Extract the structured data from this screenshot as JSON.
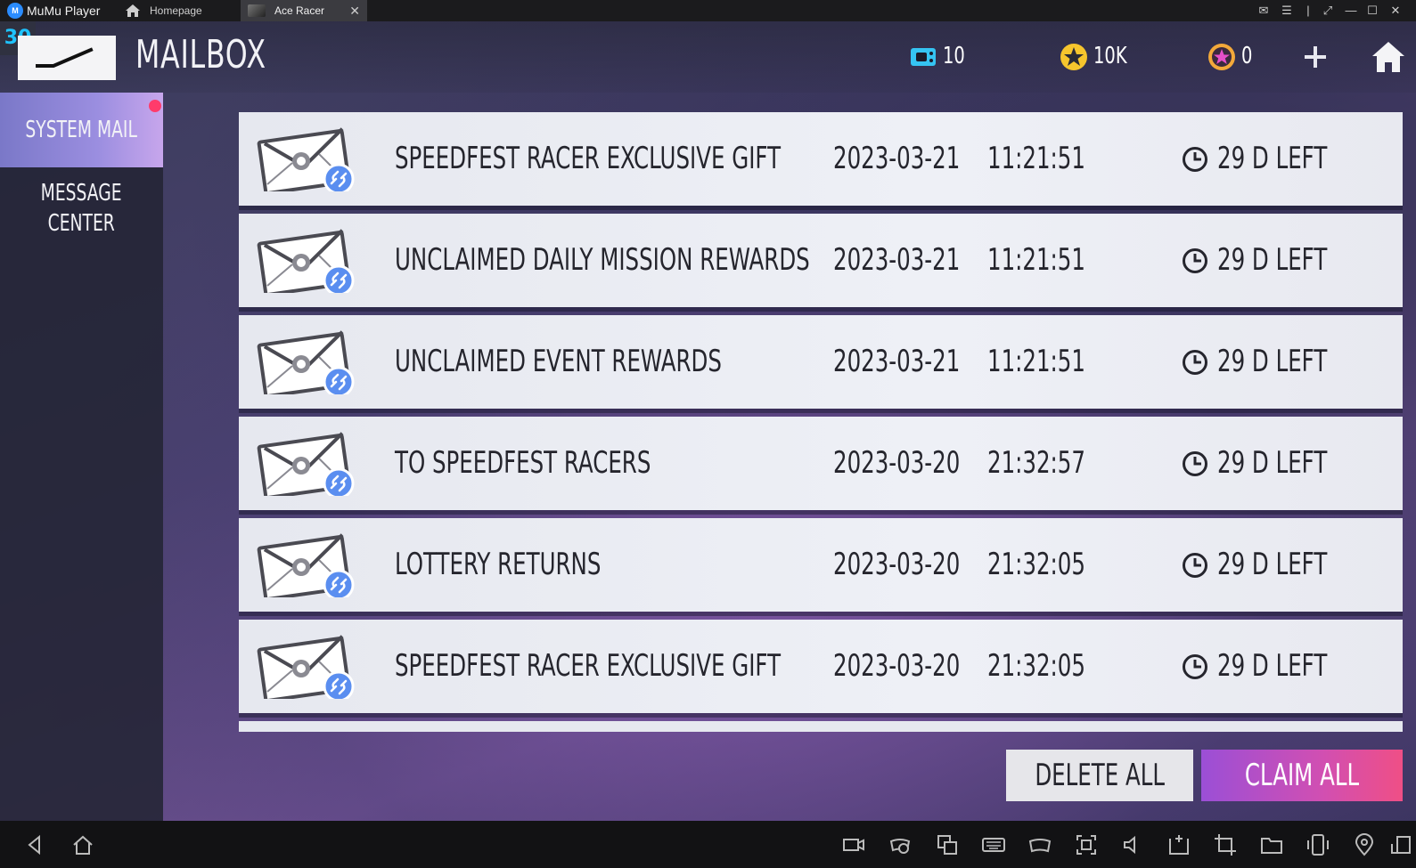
{
  "window": {
    "app_name": "MuMu Player",
    "app_logo_text": "M",
    "homepage_tab": "Homepage",
    "active_tab": "Ace Racer",
    "tab_close": "✕",
    "controls": {
      "mail": "✉",
      "menu": "☰",
      "separator": "|",
      "fullscreen": "⤢",
      "minimize": "—",
      "maximize": "☐",
      "close": "✕"
    }
  },
  "hud": {
    "fps_badge": "30",
    "page_title": "MAILBOX",
    "currencies": [
      {
        "icon": "energy-ticket-icon",
        "value": "10"
      },
      {
        "icon": "gold-star-coin-icon",
        "value": "10K"
      },
      {
        "icon": "gem-coin-icon",
        "value": "0"
      }
    ]
  },
  "sidebar": {
    "items": [
      {
        "label": "SYSTEM MAIL",
        "active": true,
        "has_notification": true
      },
      {
        "label_line1": "MESSAGE",
        "label_line2": "CENTER",
        "active": false
      }
    ]
  },
  "mails": [
    {
      "title": "SPEEDFEST RACER EXCLUSIVE GIFT",
      "date": "2023-03-21",
      "time": "11:21:51",
      "left": "29 D LEFT"
    },
    {
      "title": "UNCLAIMED DAILY MISSION REWARDS",
      "date": "2023-03-21",
      "time": "11:21:51",
      "left": "29 D LEFT"
    },
    {
      "title": "UNCLAIMED EVENT REWARDS",
      "date": "2023-03-21",
      "time": "11:21:51",
      "left": "29 D LEFT"
    },
    {
      "title": "TO SPEEDFEST RACERS",
      "date": "2023-03-20",
      "time": "21:32:57",
      "left": "29 D LEFT"
    },
    {
      "title": "LOTTERY RETURNS",
      "date": "2023-03-20",
      "time": "21:32:05",
      "left": "29 D LEFT"
    },
    {
      "title": "SPEEDFEST RACER EXCLUSIVE GIFT",
      "date": "2023-03-20",
      "time": "21:32:05",
      "left": "29 D LEFT"
    }
  ],
  "actions": {
    "delete_all": "DELETE ALL",
    "claim_all": "CLAIM ALL"
  },
  "colors": {
    "accent_claim": "#d14fb2",
    "sidebar_active": "#9b8ee0",
    "notification_dot": "#ff3b6b",
    "fps_badge": "#1ec3ff"
  },
  "navbar_icons": [
    "back-icon",
    "home-icon",
    "record-video-icon",
    "gamepad-play-icon",
    "multi-window-icon",
    "keyboard-icon",
    "gamepad-settings-icon",
    "screenshot-icon",
    "volume-icon",
    "apk-install-icon",
    "crop-icon",
    "folder-icon",
    "shake-icon",
    "location-icon",
    "rotate-icon"
  ]
}
